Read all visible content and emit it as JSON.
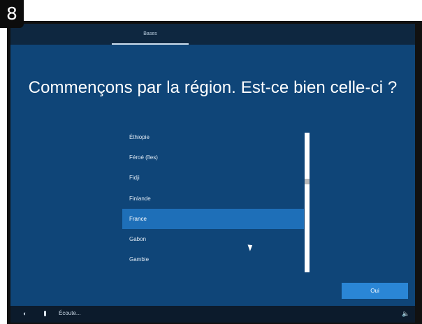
{
  "step_number": "8",
  "top_tab": {
    "label": "Bases"
  },
  "title": "Commençons par la région. Est-ce bien celle-ci ?",
  "regions": [
    {
      "label": "Éthiopie",
      "selected": false
    },
    {
      "label": "Féroé (îles)",
      "selected": false
    },
    {
      "label": "Fidji",
      "selected": false
    },
    {
      "label": "Finlande",
      "selected": false
    },
    {
      "label": "France",
      "selected": true
    },
    {
      "label": "Gabon",
      "selected": false
    },
    {
      "label": "Gambie",
      "selected": false
    }
  ],
  "confirm_button": {
    "label": "Oui"
  },
  "taskbar": {
    "status_text": "Écoute...",
    "icons": [
      "accessibility-icon",
      "microphone-icon",
      "volume-icon"
    ]
  },
  "colors": {
    "background": "#0f4578",
    "topbar": "#0e2740",
    "selected": "#1e6fb8",
    "button": "#2a86d6",
    "taskbar": "#0c1b2c"
  }
}
